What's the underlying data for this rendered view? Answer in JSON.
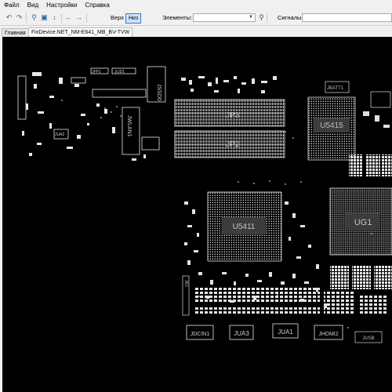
{
  "menu": [
    "Файл",
    "Вид",
    "Настройки",
    "Справка"
  ],
  "toolbar": {
    "side_top": "Верх",
    "side_bottom": "Низ",
    "elements_label": "Элементы:",
    "signals_label": "Сигналы:"
  },
  "tabs": [
    "Главная",
    "FixDevice.NET_NM-E641_MB_BV-TVW"
  ],
  "board": {
    "labels": {
      "jp3": "JP3",
      "jp2": "JP2",
      "u5415": "U5415",
      "u5411": "U5411",
      "ug1": "UG1",
      "jssd0": "JSSD0",
      "jwlan1": "JWLAN1",
      "jdcin1": "JDCIN1",
      "jua3": "JUA3",
      "jua1": "JUA1",
      "jhdmi2": "JHDMI2",
      "jbatt1": "JBATT1",
      "jfp1": "JFP1",
      "jlid1": "JLID1",
      "jrj": "JRJ",
      "jua2": "JUA2",
      "jusb": "JUSB"
    }
  }
}
